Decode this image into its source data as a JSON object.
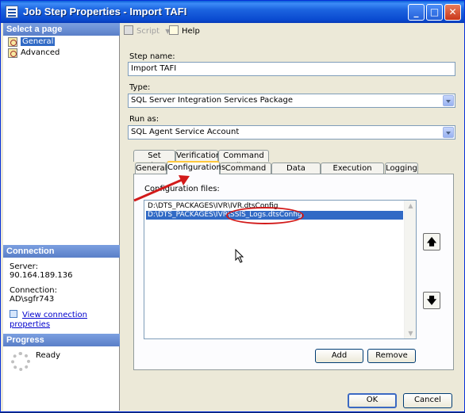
{
  "window": {
    "title": "Job Step Properties - Import TAFI"
  },
  "left_pane": {
    "select_page_header": "Select a page",
    "pages": [
      {
        "label": "General"
      },
      {
        "label": "Advanced"
      }
    ],
    "connection_header": "Connection",
    "server_label": "Server:",
    "server_value": "90.164.189.136",
    "connection_label": "Connection:",
    "connection_value": "AD\\sgfr743",
    "view_connection_link": "View connection properties",
    "progress_header": "Progress",
    "progress_status": "Ready"
  },
  "toolbar": {
    "script_label": "Script",
    "help_label": "Help"
  },
  "form": {
    "step_name_label": "Step name:",
    "step_name_value": "Import TAFI",
    "type_label": "Type:",
    "type_value": "SQL Server Integration Services Package",
    "run_as_label": "Run as:",
    "run_as_value": "SQL Agent Service Account"
  },
  "tabs_row1": [
    "Set values",
    "Verification",
    "Command line"
  ],
  "tabs_row2": [
    "General",
    "Configurations",
    "Command files",
    "Data sources",
    "Execution options",
    "Logging"
  ],
  "config": {
    "label": "Configuration files:",
    "files": [
      "D:\\DTS_PACKAGES\\IVR\\IVR.dtsConfig",
      "D:\\DTS_PACKAGES\\IVR\\SSIS_Logs.dtsConfig"
    ],
    "selected_index": 1,
    "add_label": "Add",
    "remove_label": "Remove"
  },
  "footer": {
    "ok_label": "OK",
    "cancel_label": "Cancel"
  },
  "colors": {
    "title_bar": "#0a4ad0",
    "selection": "#316ac5",
    "annotation": "#d21a1a"
  }
}
